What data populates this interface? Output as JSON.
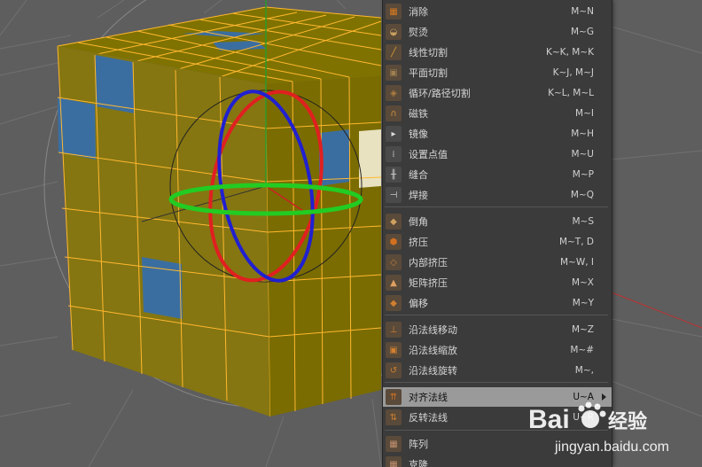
{
  "menu": {
    "items": [
      {
        "label": "消除",
        "shortcut": "M~N",
        "icon": "dissolve-icon"
      },
      {
        "label": "熨烫",
        "shortcut": "M~G",
        "icon": "iron-icon"
      },
      {
        "label": "线性切割",
        "shortcut": "K~K, M~K",
        "icon": "knife-line-icon"
      },
      {
        "label": "平面切割",
        "shortcut": "K~J, M~J",
        "icon": "plane-cut-icon"
      },
      {
        "label": "循环/路径切割",
        "shortcut": "K~L, M~L",
        "icon": "loop-cut-icon"
      },
      {
        "label": "磁铁",
        "shortcut": "M~I",
        "icon": "magnet-icon"
      },
      {
        "label": "镜像",
        "shortcut": "M~H",
        "icon": "mirror-icon"
      },
      {
        "label": "设置点值",
        "shortcut": "M~U",
        "icon": "set-point-icon"
      },
      {
        "label": "缝合",
        "shortcut": "M~P",
        "icon": "stitch-icon"
      },
      {
        "label": "焊接",
        "shortcut": "M~Q",
        "icon": "weld-icon"
      },
      {
        "label": "倒角",
        "shortcut": "M~S",
        "icon": "bevel-icon"
      },
      {
        "label": "挤压",
        "shortcut": "M~T, D",
        "icon": "extrude-icon"
      },
      {
        "label": "内部挤压",
        "shortcut": "M~W, I",
        "icon": "extrude-inner-icon"
      },
      {
        "label": "矩阵挤压",
        "shortcut": "M~X",
        "icon": "matrix-extrude-icon"
      },
      {
        "label": "偏移",
        "shortcut": "M~Y",
        "icon": "offset-icon"
      },
      {
        "label": "沿法线移动",
        "shortcut": "M~Z",
        "icon": "normal-move-icon"
      },
      {
        "label": "沿法线缩放",
        "shortcut": "M~#",
        "icon": "normal-scale-icon"
      },
      {
        "label": "沿法线旋转",
        "shortcut": "M~,",
        "icon": "normal-rotate-icon"
      },
      {
        "label": "对齐法线",
        "shortcut": "U~A",
        "icon": "align-normals-icon"
      },
      {
        "label": "反转法线",
        "shortcut": "U~R",
        "icon": "reverse-normals-icon"
      },
      {
        "label": "阵列",
        "shortcut": "",
        "icon": "array-icon"
      },
      {
        "label": "克隆",
        "shortcut": "",
        "icon": "clone-icon"
      }
    ]
  },
  "watermark": {
    "brand": "Bai",
    "brand2": "百",
    "suffix": "经验",
    "url": "jingyan.baidu.com"
  },
  "colors": {
    "face": "#7f7200",
    "face_alt": "#8b7c10",
    "edge": "#ffb830",
    "blue_face": "#3b6ea0",
    "menu_bg": "#3b3b3b",
    "highlight": "#9a9a9a"
  }
}
